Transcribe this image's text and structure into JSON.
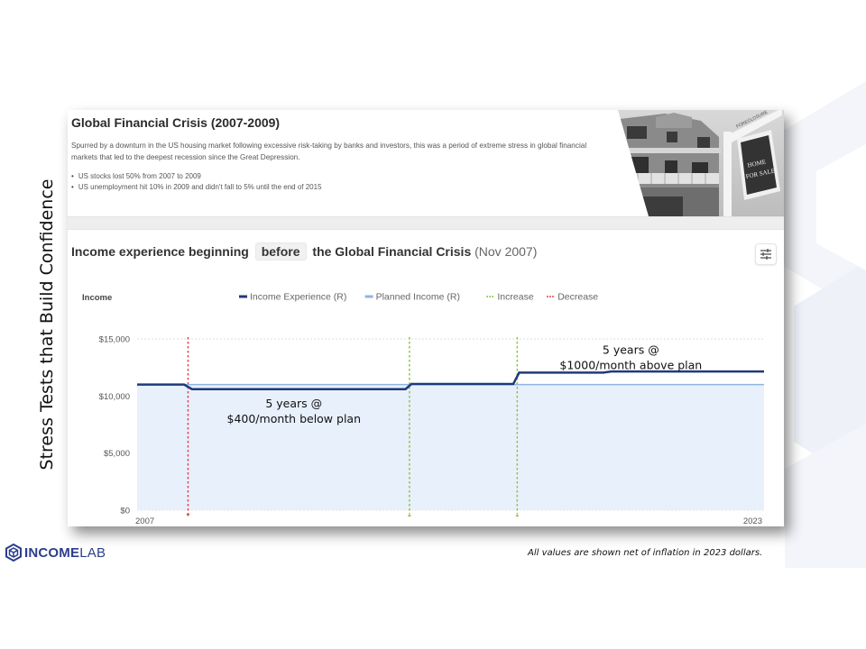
{
  "slide": {
    "side_title": "Stress Tests that Build Confidence",
    "footnote": "All values are shown net of inflation in 2023 dollars.",
    "logo": {
      "icon": "incomelab-hex-logo-icon",
      "bold": "INCOME",
      "light": "LAB",
      "color": "#2c3e8c"
    }
  },
  "scenario": {
    "title": "Global Financial Crisis (2007-2009)",
    "description": "Spurred by a downturn in the US housing market following excessive risk-taking by banks and investors, this was a period of extreme stress in global financial markets that led to the deepest recession since the Great Depression.",
    "bullets": [
      "US stocks lost 50% from 2007 to 2009",
      "US unemployment hit 10% in 2009 and didn't fall to 5% until the end of 2015"
    ],
    "photo": {
      "description": "house-with-home-for-sale-foreclosure-sign",
      "sign_top": "FORECLOSURE",
      "sign_line1": "HOME",
      "sign_line2": "FOR SALE"
    }
  },
  "chart_header": {
    "prefix": "Income experience beginning",
    "pill": "before",
    "suffix": "the Global Financial Crisis",
    "date": "(Nov 2007)",
    "settings_icon": "sliders-icon"
  },
  "chart_data": {
    "type": "line",
    "title": "Income experience beginning before the Global Financial Crisis (Nov 2007)",
    "ylabel": "Income",
    "xlabel": "",
    "x_range": [
      2007,
      2023
    ],
    "ylim": [
      0,
      15000
    ],
    "y_ticks": [
      0,
      5000,
      10000,
      15000
    ],
    "y_tick_labels": [
      "$0",
      "$5,000",
      "$10,000",
      "$15,000"
    ],
    "x_tick_labels": [
      "2007",
      "2023"
    ],
    "grid": true,
    "legend": [
      {
        "label": "Income Experience (R)",
        "color": "#1f3a7a",
        "style": "solid"
      },
      {
        "label": "Planned Income (R)",
        "color": "#8fb4e3",
        "style": "solid"
      },
      {
        "label": "Increase",
        "color": "#8dc63f",
        "style": "dotted"
      },
      {
        "label": "Decrease",
        "color": "#e0474c",
        "style": "dotted"
      }
    ],
    "legend_position": "top",
    "series": [
      {
        "name": "Income Experience (R)",
        "color": "#1f3a7a",
        "x": [
          2007,
          2008.2,
          2008.4,
          2013.85,
          2014.0,
          2016.6,
          2016.75,
          2018.9,
          2019.1,
          2023
        ],
        "y": [
          11000,
          11000,
          10600,
          10600,
          11050,
          11050,
          12050,
          12050,
          12150,
          12150
        ]
      },
      {
        "name": "Planned Income (R)",
        "color": "#8fb4e3",
        "x": [
          2007,
          2023
        ],
        "y": [
          11000,
          11000
        ]
      }
    ],
    "markers": [
      {
        "type": "Decrease",
        "x": 2008.3
      },
      {
        "type": "Increase",
        "x": 2013.95
      },
      {
        "type": "Increase",
        "x": 2016.7
      }
    ],
    "annotations": [
      {
        "line1": "5 years @",
        "line2": "$400/month  below plan",
        "x": 2011.0,
        "y": 9000
      },
      {
        "line1": "5 years @",
        "line2": "$1000/month  above plan",
        "x": 2019.6,
        "y": 13700
      }
    ]
  }
}
